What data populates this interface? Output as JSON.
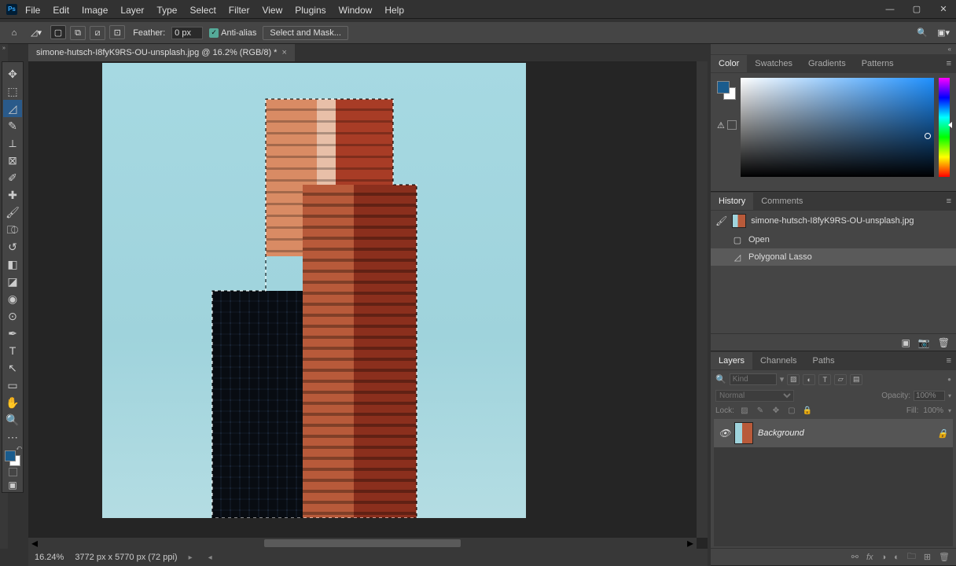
{
  "menubar": [
    "File",
    "Edit",
    "Image",
    "Layer",
    "Type",
    "Select",
    "Filter",
    "View",
    "Plugins",
    "Window",
    "Help"
  ],
  "optbar": {
    "feather_label": "Feather:",
    "feather_value": "0 px",
    "anti_alias": "Anti-alias",
    "select_mask": "Select and Mask..."
  },
  "tab": {
    "title": "simone-hutsch-I8fyK9RS-OU-unsplash.jpg @ 16.2% (RGB/8) *"
  },
  "color_tabs": [
    "Color",
    "Swatches",
    "Gradients",
    "Patterns"
  ],
  "history_tabs": [
    "History",
    "Comments"
  ],
  "history": {
    "source": "simone-hutsch-I8fyK9RS-OU-unsplash.jpg",
    "items": [
      {
        "label": "Open",
        "icon": "▢",
        "active": false
      },
      {
        "label": "Polygonal Lasso",
        "icon": "◿",
        "active": true
      }
    ]
  },
  "layers_tabs": [
    "Layers",
    "Channels",
    "Paths"
  ],
  "layers": {
    "filter_placeholder": "Kind",
    "blend": "Normal",
    "opacity_label": "Opacity:",
    "opacity_val": "100%",
    "lock_label": "Lock:",
    "fill_label": "Fill:",
    "fill_val": "100%",
    "items": [
      {
        "name": "Background",
        "locked": true
      }
    ]
  },
  "status": {
    "zoom": "16.24%",
    "dims": "3772 px x 5770 px (72 ppi)"
  }
}
